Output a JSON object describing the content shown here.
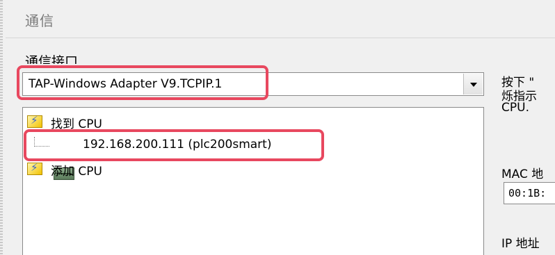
{
  "section": {
    "title": "通信"
  },
  "interface": {
    "label": "通信接口",
    "selected": "TAP-Windows Adapter V9.TCPIP.1"
  },
  "tree": {
    "found_cpu": "找到 CPU",
    "device": "192.168.200.111 (plc200smart)",
    "add_cpu": "添加 CPU"
  },
  "right_panel": {
    "instruction_line1": "按下 \"",
    "instruction_line2": "烁指示",
    "instruction_line3": "CPU.",
    "mac_label": "MAC 地",
    "mac_value": "00:1B:",
    "ip_label": "IP 地址"
  },
  "colors": {
    "highlight": "#e8485f",
    "background": "#f0f0f0"
  },
  "icons": {
    "dropdown": "chevron-down-icon",
    "cpu": "cpu-folder-icon",
    "device": "plc-device-icon"
  }
}
